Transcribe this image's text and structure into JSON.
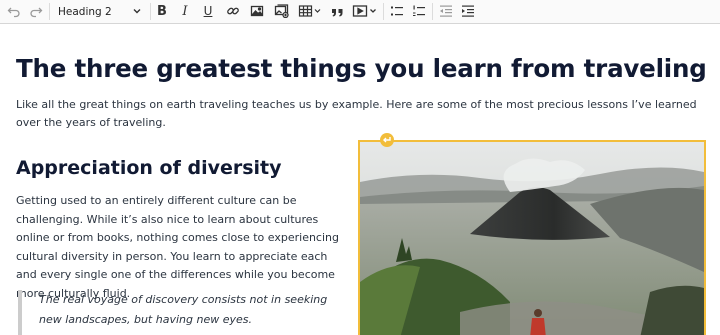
{
  "toolbar": {
    "heading_select": "Heading 2",
    "bold_glyph": "B",
    "italic_glyph": "I",
    "underline_glyph": "U",
    "icons": [
      "undo-icon",
      "redo-icon",
      "bold-icon",
      "italic-icon",
      "underline-icon",
      "link-icon",
      "image-icon",
      "media-library-icon",
      "table-icon",
      "blockquote-icon",
      "media-embed-icon",
      "bulleted-list-icon",
      "numbered-list-icon",
      "outdent-icon",
      "indent-icon"
    ]
  },
  "article": {
    "title": "The three greatest things you learn from traveling",
    "intro": "Like all the great things on earth traveling teaches us by example. Here are some of the most precious lessons I’ve learned over the years of traveling.",
    "section_heading": "Appreciation of diversity",
    "section_body": "Getting used to an entirely different culture can be challenging. While it’s also nice to learn about cultures online or from books, nothing comes close to experiencing cultural diversity in person. You learn to appreciate each and every single one of the differences while you become more culturally fluid.",
    "quote": "The real voyage of discovery consists not in seeking new landscapes, but having new eyes."
  },
  "colors": {
    "selection_accent": "#f2bd3a",
    "heading": "#111a33",
    "text": "#2b3440"
  }
}
